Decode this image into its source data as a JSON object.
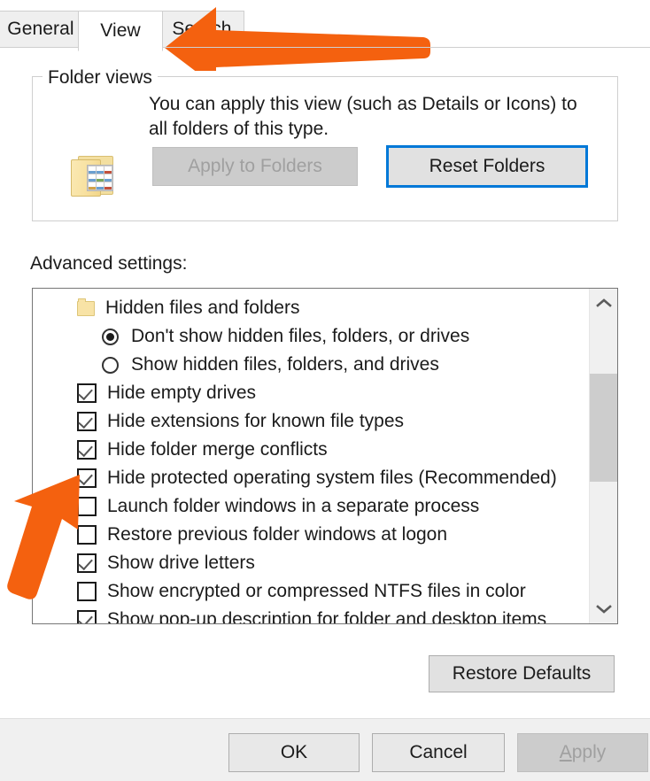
{
  "dialog": {
    "tabs": [
      {
        "label": "General",
        "active": false
      },
      {
        "label": "View",
        "active": true
      },
      {
        "label": "Search",
        "active": false
      }
    ]
  },
  "folder_views": {
    "legend": "Folder views",
    "description": "You can apply this view (such as Details or Icons) to all folders of this type.",
    "apply_to_folders_label": "Apply to Folders",
    "reset_folders_label": "Reset Folders",
    "icon": "folder-views-icon"
  },
  "advanced": {
    "label": "Advanced settings:",
    "items": [
      {
        "type": "header",
        "label": "Hidden files and folders",
        "icon": "folder-icon"
      },
      {
        "type": "radio",
        "label": "Don't show hidden files, folders, or drives",
        "checked": true
      },
      {
        "type": "radio",
        "label": "Show hidden files, folders, and drives",
        "checked": false
      },
      {
        "type": "check",
        "label": "Hide empty drives",
        "checked": true
      },
      {
        "type": "check",
        "label": "Hide extensions for known file types",
        "checked": true
      },
      {
        "type": "check",
        "label": "Hide folder merge conflicts",
        "checked": true
      },
      {
        "type": "check",
        "label": "Hide protected operating system files (Recommended)",
        "checked": true
      },
      {
        "type": "check",
        "label": "Launch folder windows in a separate process",
        "checked": false
      },
      {
        "type": "check",
        "label": "Restore previous folder windows at logon",
        "checked": false
      },
      {
        "type": "check",
        "label": "Show drive letters",
        "checked": true
      },
      {
        "type": "check",
        "label": "Show encrypted or compressed NTFS files in color",
        "checked": false
      },
      {
        "type": "check",
        "label": "Show pop-up description for folder and desktop items",
        "checked": true
      }
    ],
    "scrollbar": {
      "up_arrow": "chevron-up-icon",
      "down_arrow": "chevron-down-icon"
    },
    "restore_defaults_label": "Restore Defaults"
  },
  "footer": {
    "ok_label": "OK",
    "cancel_label": "Cancel",
    "apply_label_accel": "A",
    "apply_label_rest": "pply"
  },
  "annotations": {
    "color": "#F4610F",
    "arrows": [
      {
        "name": "arrow-pointing-to-view-tab",
        "direction": "left"
      },
      {
        "name": "arrow-pointing-to-launch-folder-windows-checkbox",
        "direction": "up-right"
      }
    ]
  }
}
